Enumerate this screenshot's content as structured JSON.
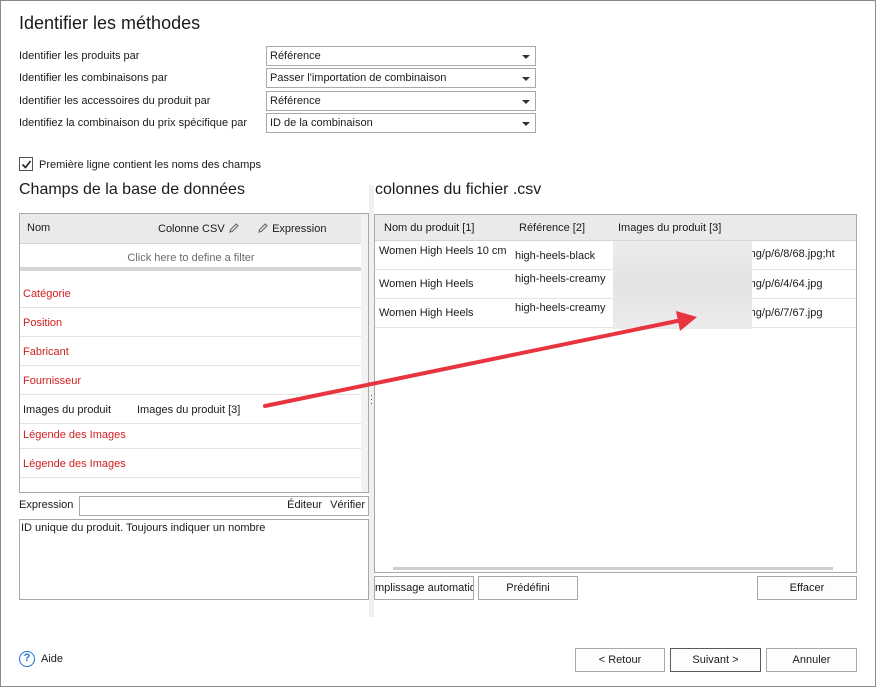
{
  "page": {
    "title": "Identifier les méthodes"
  },
  "methods": [
    {
      "label": "Identifier les produits par",
      "value": "Référence"
    },
    {
      "label": "Identifier les combinaisons par",
      "value": "Passer l'importation de combinaison"
    },
    {
      "label": "Identifier les accessoires du produit par",
      "value": "Référence"
    },
    {
      "label": "Identifiez la combinaison du prix spécifique par",
      "value": "ID de la combinaison"
    }
  ],
  "first_line_checkbox": {
    "label": "Première ligne contient les noms des champs",
    "checked": true
  },
  "left_panel": {
    "heading": "Champs de la base de données",
    "columns": {
      "nom": "Nom",
      "colonne_csv": "Colonne CSV",
      "expression": "Expression"
    },
    "filter_text": "Click here to define a filter",
    "rows": [
      {
        "name": "Catégorie",
        "csv": "",
        "required": true
      },
      {
        "name": "Position",
        "csv": "",
        "required": true
      },
      {
        "name": "Fabricant",
        "csv": "",
        "required": true
      },
      {
        "name": "Fournisseur",
        "csv": "",
        "required": true
      },
      {
        "name": "Images du produit",
        "csv": "Images du produit [3]",
        "required": false
      },
      {
        "name": "Légende des Images",
        "csv": "",
        "required": true
      },
      {
        "name": "Légende des Images",
        "csv": "",
        "required": true
      }
    ],
    "expression_label": "Expression",
    "editor_label": "Éditeur",
    "verify_label": "Vérifier",
    "description": "ID unique du produit. Toujours indiquer un nombre"
  },
  "right_panel": {
    "heading": "colonnes du fichier .csv",
    "columns": [
      "Nom du produit [1]",
      "Référence [2]",
      "Images du produit [3]"
    ],
    "rows": [
      {
        "nom": "Women High Heels 10 cm",
        "ref": "high-heels-black",
        "img": "p/img/p/6/8/68.jpg;ht"
      },
      {
        "nom": "Women High Heels",
        "ref": "high-heels-creamy",
        "img": "p/img/p/6/4/64.jpg"
      },
      {
        "nom": "Women High Heels",
        "ref": "high-heels-creamy",
        "img": "p/img/p/6/7/67.jpg"
      }
    ]
  },
  "buttons": {
    "autofill": "mplissage automatiq",
    "predefined": "Prédéfini",
    "clear": "Effacer",
    "back": "< Retour",
    "next": "Suivant >",
    "cancel": "Annuler",
    "help": "Aide"
  },
  "colors": {
    "required_field": "#d01f1f",
    "arrow": "#e8343f",
    "help_icon": "#1e6fd0"
  },
  "icons": {
    "pencil": "pencil-icon",
    "help": "help-circle-icon",
    "check": "checkmark-icon",
    "dropdown": "caret-down-icon"
  }
}
